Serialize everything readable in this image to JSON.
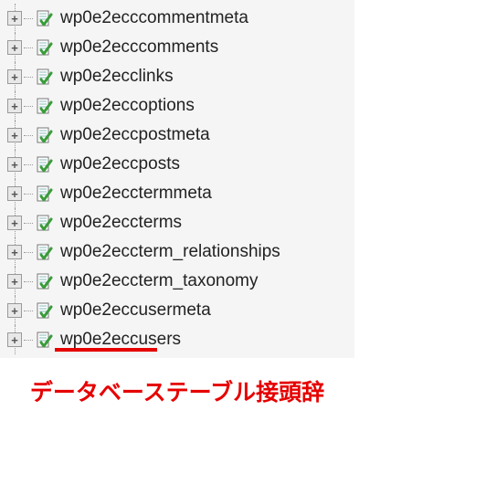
{
  "tree": {
    "items": [
      {
        "label": "wp0e2ecccommentmeta",
        "underlined": false
      },
      {
        "label": "wp0e2ecccomments",
        "underlined": false
      },
      {
        "label": "wp0e2ecclinks",
        "underlined": false
      },
      {
        "label": "wp0e2eccoptions",
        "underlined": false
      },
      {
        "label": "wp0e2eccpostmeta",
        "underlined": false
      },
      {
        "label": "wp0e2eccposts",
        "underlined": false
      },
      {
        "label": "wp0e2ecctermmeta",
        "underlined": false
      },
      {
        "label": "wp0e2eccterms",
        "underlined": false
      },
      {
        "label": "wp0e2eccterm_relationships",
        "underlined": false
      },
      {
        "label": "wp0e2eccterm_taxonomy",
        "underlined": false
      },
      {
        "label": "wp0e2eccusermeta",
        "underlined": false
      },
      {
        "label": "wp0e2eccusers",
        "underlined": true
      }
    ]
  },
  "caption": "データベーステーブル接頭辞"
}
